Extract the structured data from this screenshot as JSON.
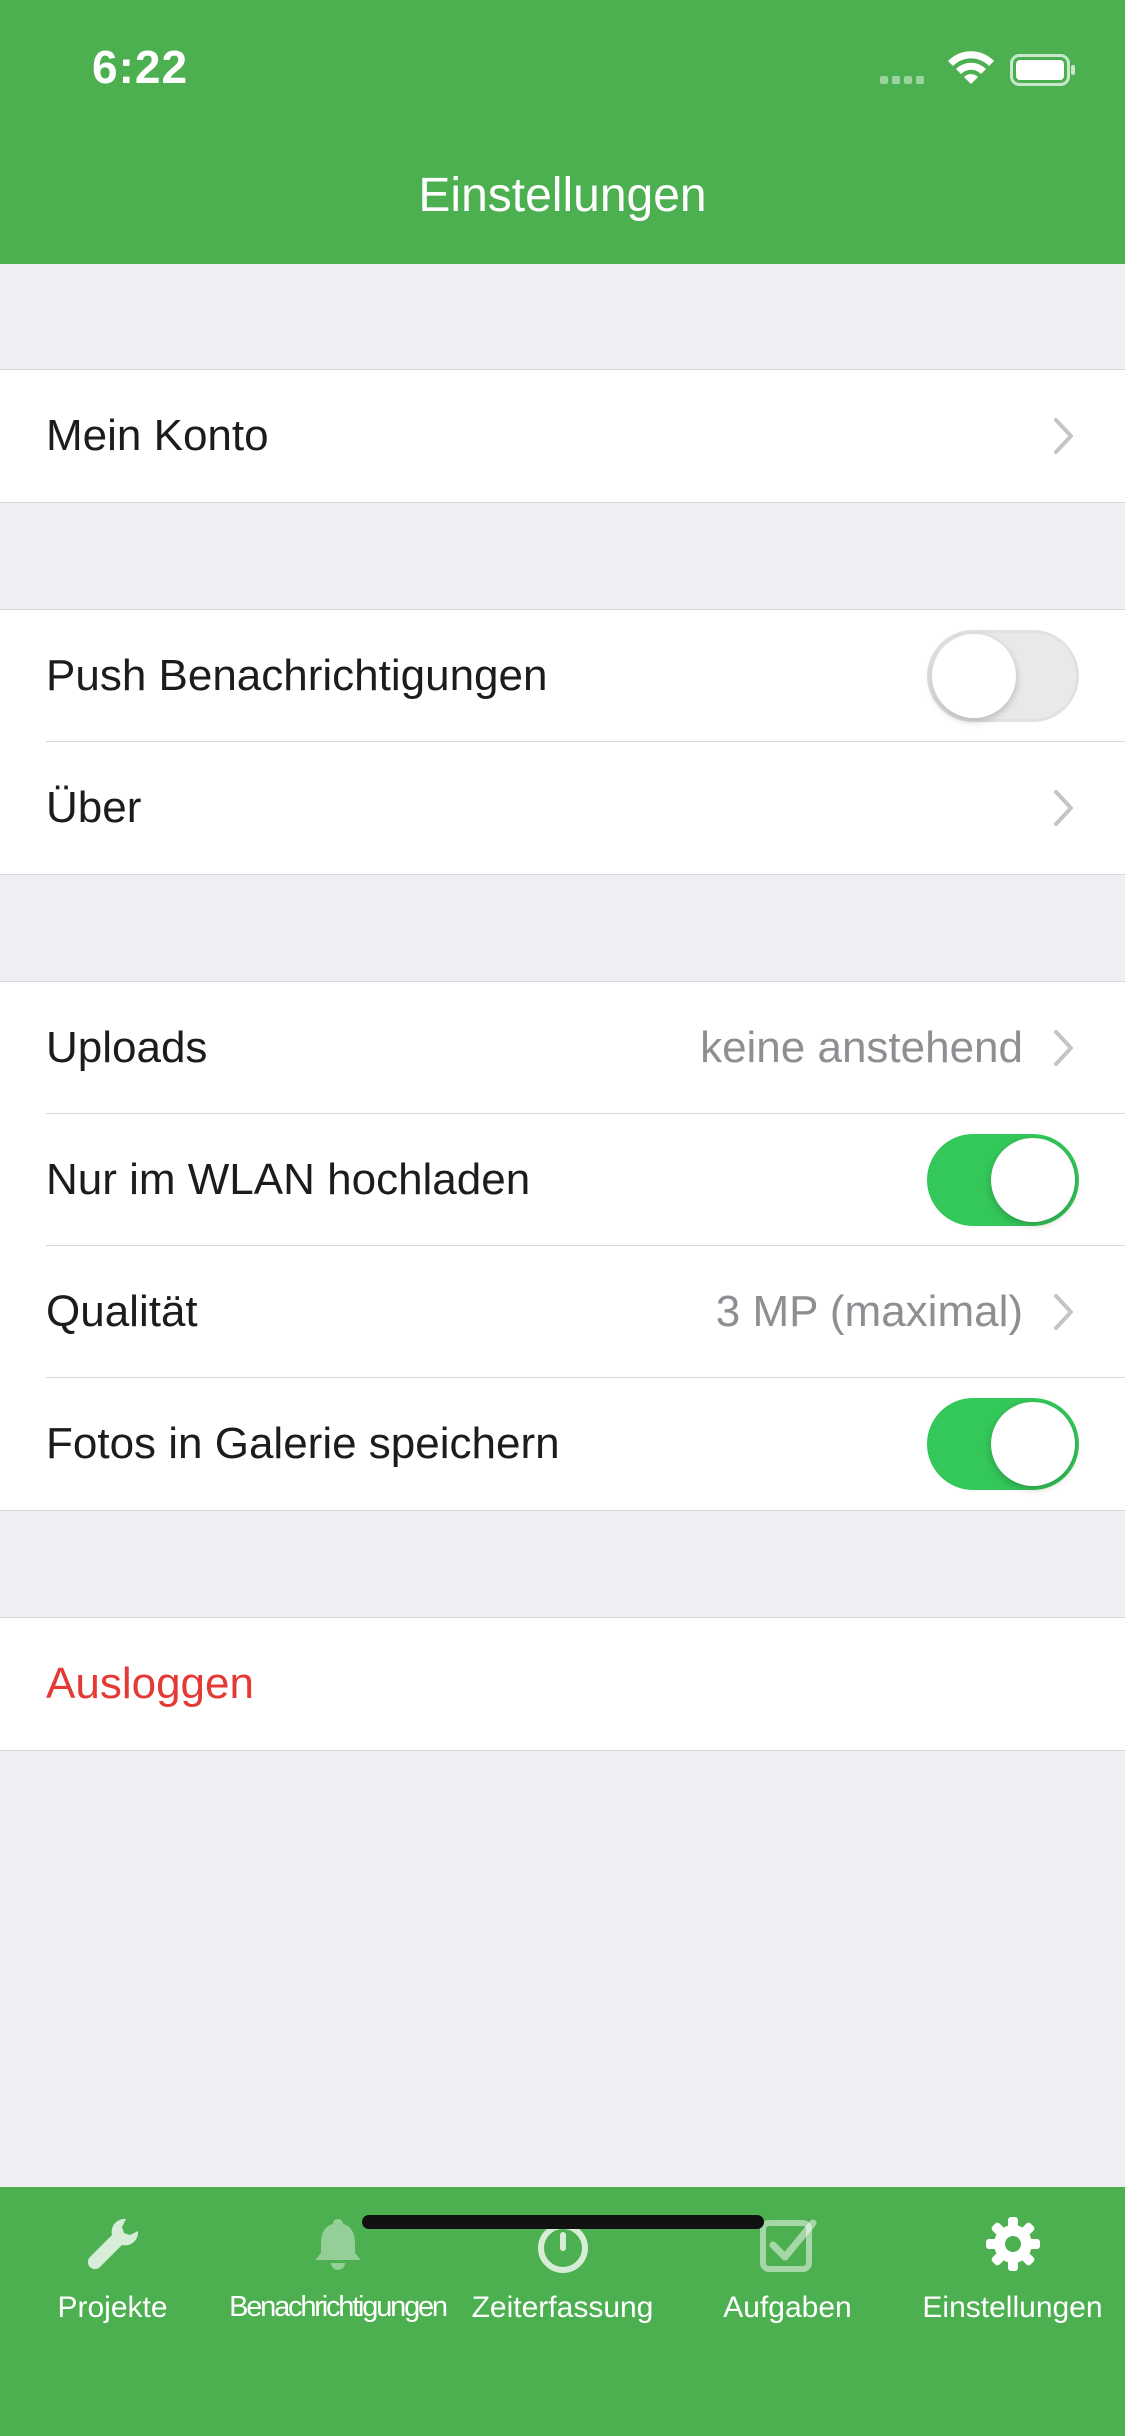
{
  "status_bar": {
    "time": "6:22"
  },
  "nav": {
    "title": "Einstellungen"
  },
  "groups": {
    "account": {
      "my_account": {
        "label": "Mein Konto"
      }
    },
    "general": {
      "push": {
        "label": "Push Benachrichtigungen",
        "enabled": false
      },
      "about": {
        "label": "Über"
      }
    },
    "uploads": {
      "uploads": {
        "label": "Uploads",
        "value": "keine anstehend"
      },
      "wifi_only": {
        "label": "Nur im WLAN hochladen",
        "enabled": true
      },
      "quality": {
        "label": "Qualität",
        "value": "3 MP (maximal)"
      },
      "save_gallery": {
        "label": "Fotos in Galerie speichern",
        "enabled": true
      }
    },
    "session": {
      "logout": {
        "label": "Ausloggen"
      }
    }
  },
  "tabbar": {
    "tabs": [
      {
        "label": "Projekte",
        "icon": "wrench-icon",
        "active": false
      },
      {
        "label": "Benachrichtigungen",
        "icon": "bell-icon",
        "active": false
      },
      {
        "label": "Zeiterfassung",
        "icon": "stopwatch-icon",
        "active": false
      },
      {
        "label": "Aufgaben",
        "icon": "checkbox-icon",
        "active": false
      },
      {
        "label": "Einstellungen",
        "icon": "gear-icon",
        "active": true
      }
    ]
  },
  "colors": {
    "brand": "#4caf50",
    "toggle_on": "#34c759",
    "danger": "#e53935",
    "background": "#efeff4"
  }
}
